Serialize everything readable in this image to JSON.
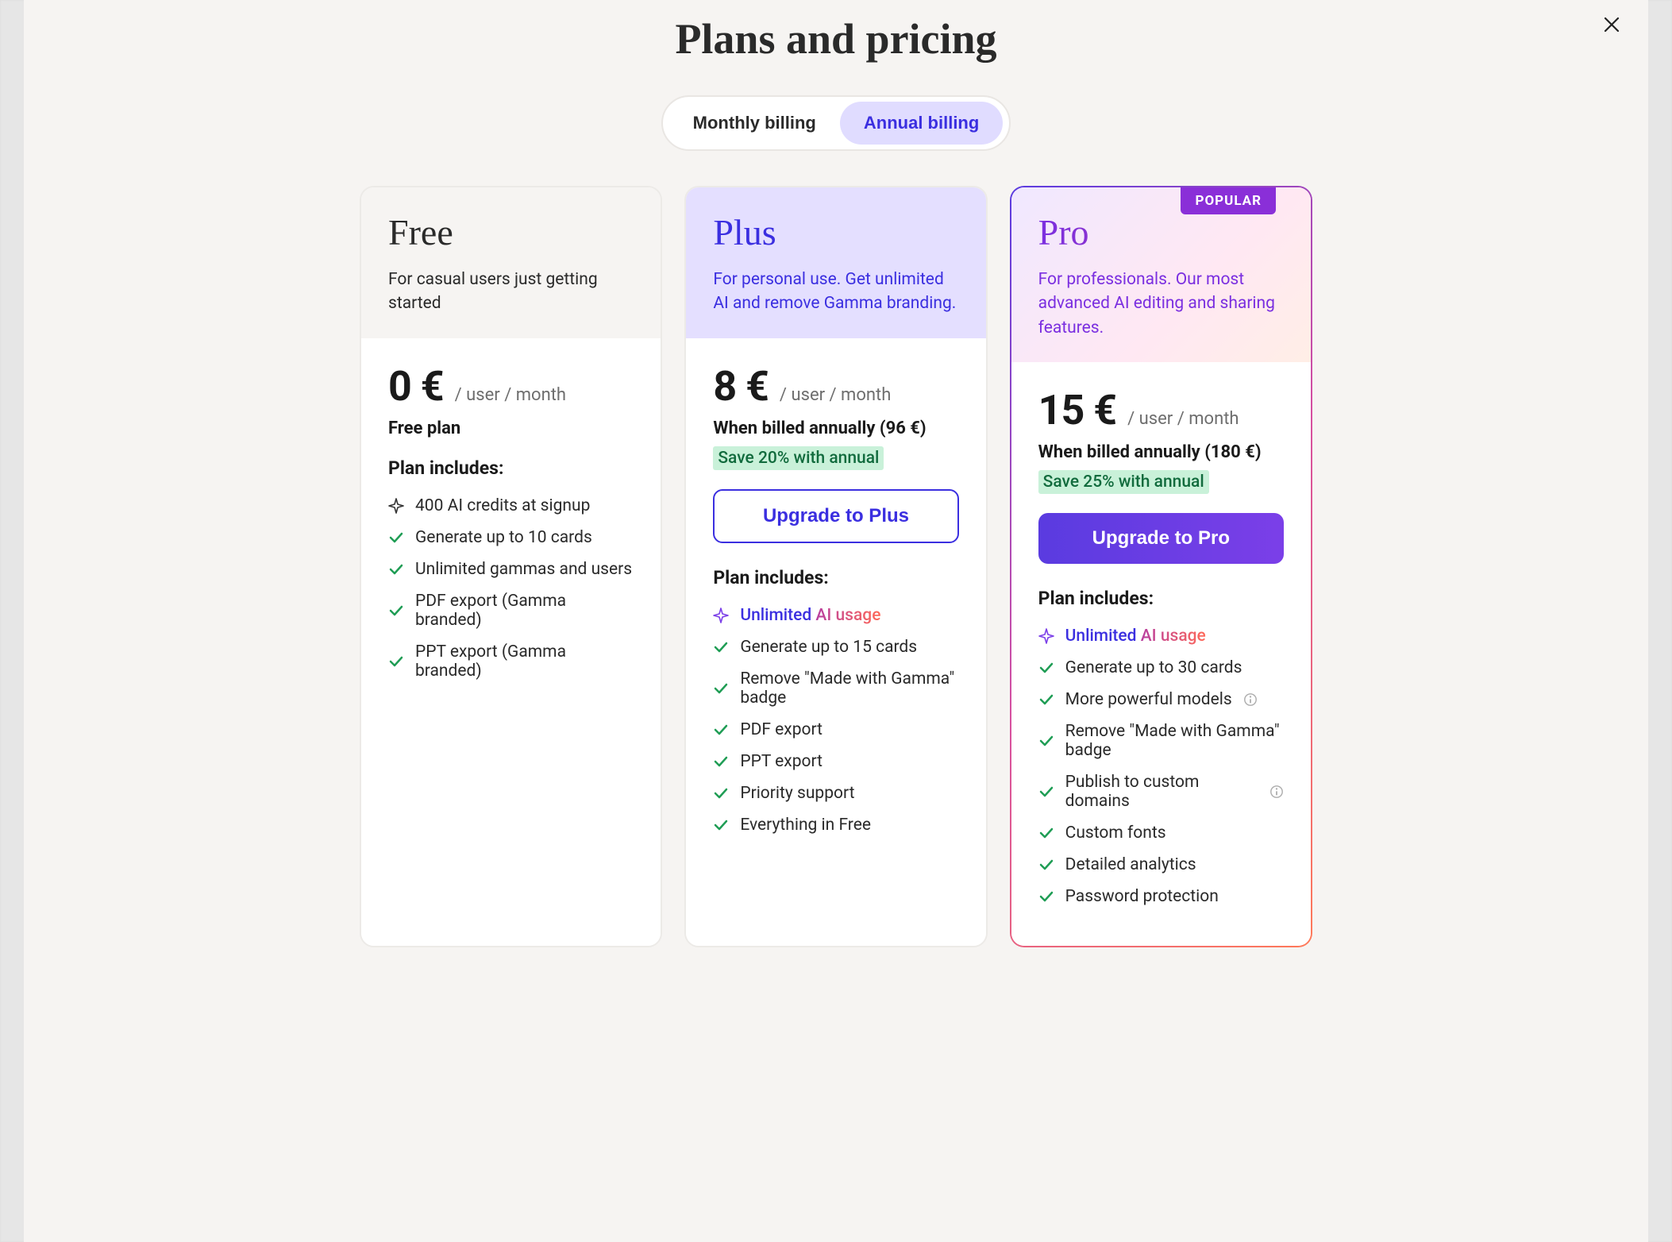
{
  "title": "Plans and pricing",
  "close_label": "Close",
  "billing": {
    "monthly": "Monthly billing",
    "annual": "Annual billing",
    "active": "annual"
  },
  "popular_badge": "POPULAR",
  "price_suffix": "/ user / month",
  "includes_title": "Plan includes:",
  "plans": {
    "free": {
      "name": "Free",
      "desc": "For casual users just getting started",
      "price": "0 €",
      "note": "Free plan",
      "features": [
        {
          "icon": "sparkle",
          "text": "400 AI credits at signup"
        },
        {
          "icon": "check",
          "text": "Generate up to 10 cards"
        },
        {
          "icon": "check",
          "text": "Unlimited gammas and users"
        },
        {
          "icon": "check",
          "text": "PDF export (Gamma branded)"
        },
        {
          "icon": "check",
          "text": "PPT export (Gamma branded)"
        }
      ]
    },
    "plus": {
      "name": "Plus",
      "desc": "For personal use. Get unlimited AI and remove Gamma branding.",
      "price": "8 €",
      "billed_note": "When billed annually (96 €)",
      "savings": "Save 20% with annual",
      "cta": "Upgrade to Plus",
      "features": [
        {
          "icon": "sparkle",
          "highlight": true,
          "unlimited": "Unlimited",
          "usage": "AI usage"
        },
        {
          "icon": "check",
          "text": "Generate up to 15 cards"
        },
        {
          "icon": "check",
          "text": "Remove \"Made with Gamma\" badge"
        },
        {
          "icon": "check",
          "text": "PDF export"
        },
        {
          "icon": "check",
          "text": "PPT export"
        },
        {
          "icon": "check",
          "text": "Priority support"
        },
        {
          "icon": "check",
          "text": "Everything in Free"
        }
      ]
    },
    "pro": {
      "name": "Pro",
      "desc": "For professionals. Our most advanced AI editing and sharing features.",
      "price": "15 €",
      "billed_note": "When billed annually (180 €)",
      "savings": "Save 25% with annual",
      "cta": "Upgrade to Pro",
      "features": [
        {
          "icon": "sparkle",
          "highlight": true,
          "unlimited": "Unlimited",
          "usage": "AI usage"
        },
        {
          "icon": "check",
          "text": "Generate up to 30 cards"
        },
        {
          "icon": "check",
          "text": "More powerful models",
          "info": true
        },
        {
          "icon": "check",
          "text": "Remove \"Made with Gamma\" badge"
        },
        {
          "icon": "check",
          "text": "Publish to custom domains",
          "info": true
        },
        {
          "icon": "check",
          "text": "Custom fonts"
        },
        {
          "icon": "check",
          "text": "Detailed analytics"
        },
        {
          "icon": "check",
          "text": "Password protection"
        }
      ]
    }
  }
}
